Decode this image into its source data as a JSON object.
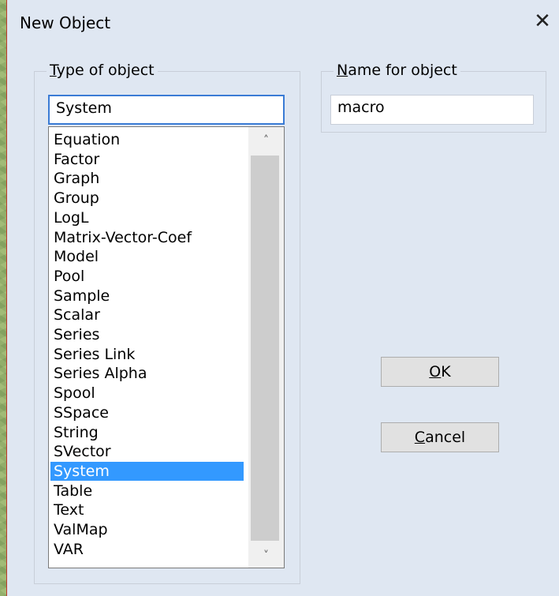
{
  "dialog": {
    "title": "New Object"
  },
  "type_group": {
    "label_prefix": "",
    "label_accel": "T",
    "label_rest": "ype of object",
    "selected_value": "System",
    "items": [
      "Equation",
      "Factor",
      "Graph",
      "Group",
      "LogL",
      "Matrix-Vector-Coef",
      "Model",
      "Pool",
      "Sample",
      "Scalar",
      "Series",
      "Series Link",
      "Series Alpha",
      "Spool",
      "SSpace",
      "String",
      "SVector",
      "System",
      "Table",
      "Text",
      "ValMap",
      "VAR"
    ],
    "selected_index": 17
  },
  "name_group": {
    "label_accel": "N",
    "label_rest": "ame for object",
    "value": "macro"
  },
  "buttons": {
    "ok_accel": "O",
    "ok_rest": "K",
    "cancel_accel": "C",
    "cancel_rest": "ancel"
  },
  "icons": {
    "close": "close-icon",
    "scroll_up": "chevron-up-icon",
    "scroll_down": "chevron-down-icon"
  }
}
